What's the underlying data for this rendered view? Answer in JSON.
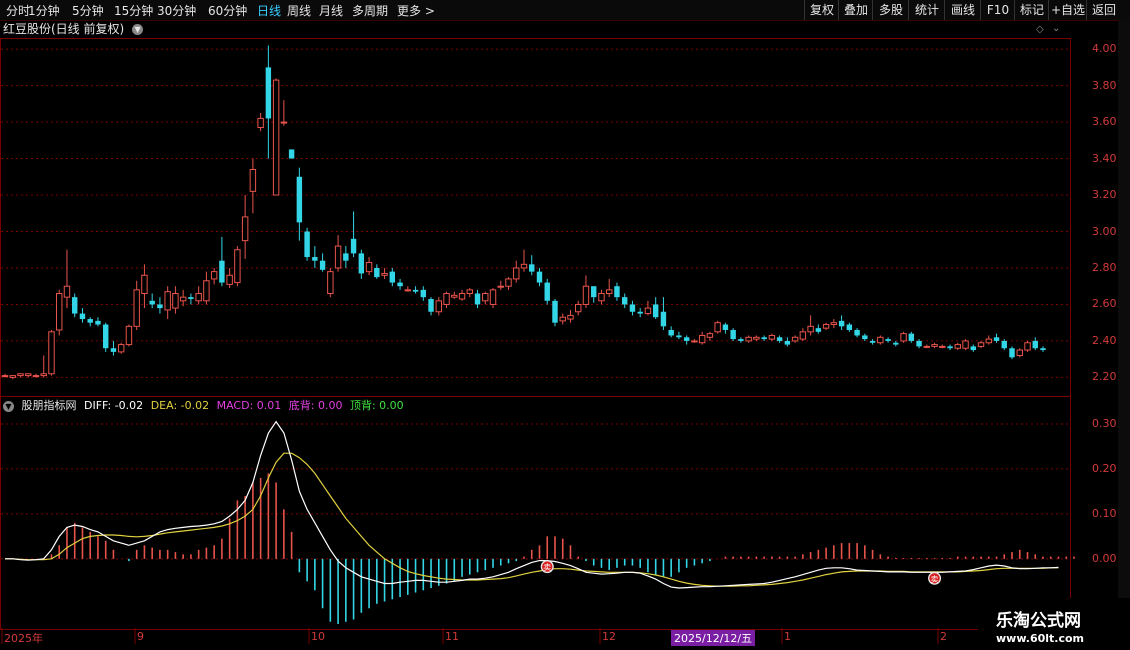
{
  "toolbar": {
    "periods": [
      "分时",
      "1分钟",
      "5分钟",
      "15分钟",
      "30分钟",
      "60分钟",
      "日线",
      "周线",
      "月线",
      "多周期",
      "更多 >"
    ],
    "active_period": "日线",
    "right_buttons": [
      "复权",
      "叠加",
      "多股",
      "统计",
      "画线",
      "F10",
      "标记",
      "+自选",
      "返回"
    ]
  },
  "stock": {
    "title": "红豆股份(日线 前复权)"
  },
  "indicator": {
    "name": "股朋指标网",
    "diff": "DIFF: -0.02",
    "dea": "DEA: -0.02",
    "macd": "MACD: 0.01",
    "dibei": "底背: 0.00",
    "dingbei": "顶背: 0.00"
  },
  "price_axis": [
    "4.00",
    "3.80",
    "3.60",
    "3.40",
    "3.20",
    "3.00",
    "2.80",
    "2.60",
    "2.40",
    "2.20"
  ],
  "macd_axis": [
    "0.30",
    "0.20",
    "0.10",
    "0.00"
  ],
  "x_axis": [
    "2025年",
    "9",
    "10",
    "11",
    "12",
    "1",
    "2"
  ],
  "selected_date": "2025/12/12/五",
  "markers": [
    "卖",
    "卖"
  ],
  "watermark": {
    "line1": "乐淘公式网",
    "line2": "www.60lt.com"
  },
  "colors": {
    "up": "#e8544b",
    "down": "#33d6e6",
    "diff": "#ffffff",
    "dea": "#e0d040",
    "macd_label": "#e040e0",
    "dibei": "#e040e0",
    "dingbei": "#40e040",
    "grid": "#7a0000"
  },
  "chart_data": {
    "type": "candlestick",
    "ylim": [
      2.12,
      4.05
    ],
    "candles": [
      [
        2.21,
        2.21,
        2.2,
        2.22
      ],
      [
        2.2,
        2.21,
        2.19,
        2.21
      ],
      [
        2.21,
        2.22,
        2.2,
        2.22
      ],
      [
        2.21,
        2.22,
        2.2,
        2.22
      ],
      [
        2.21,
        2.21,
        2.2,
        2.22
      ],
      [
        2.21,
        2.22,
        2.2,
        2.32
      ],
      [
        2.22,
        2.45,
        2.21,
        2.46
      ],
      [
        2.46,
        2.66,
        2.43,
        2.68
      ],
      [
        2.64,
        2.7,
        2.58,
        2.9
      ],
      [
        2.64,
        2.55,
        2.53,
        2.66
      ],
      [
        2.55,
        2.52,
        2.5,
        2.58
      ],
      [
        2.52,
        2.5,
        2.48,
        2.53
      ],
      [
        2.51,
        2.49,
        2.48,
        2.53
      ],
      [
        2.49,
        2.36,
        2.34,
        2.5
      ],
      [
        2.36,
        2.34,
        2.32,
        2.4
      ],
      [
        2.34,
        2.38,
        2.33,
        2.39
      ],
      [
        2.38,
        2.48,
        2.37,
        2.49
      ],
      [
        2.48,
        2.68,
        2.46,
        2.73
      ],
      [
        2.66,
        2.76,
        2.58,
        2.82
      ],
      [
        2.62,
        2.6,
        2.58,
        2.66
      ],
      [
        2.6,
        2.58,
        2.55,
        2.64
      ],
      [
        2.57,
        2.67,
        2.52,
        2.7
      ],
      [
        2.58,
        2.66,
        2.55,
        2.7
      ],
      [
        2.62,
        2.64,
        2.59,
        2.68
      ],
      [
        2.64,
        2.63,
        2.6,
        2.66
      ],
      [
        2.62,
        2.66,
        2.6,
        2.7
      ],
      [
        2.62,
        2.73,
        2.6,
        2.78
      ],
      [
        2.74,
        2.78,
        2.71,
        2.8
      ],
      [
        2.84,
        2.72,
        2.7,
        2.97
      ],
      [
        2.71,
        2.76,
        2.69,
        2.8
      ],
      [
        2.72,
        2.9,
        2.7,
        2.92
      ],
      [
        2.95,
        3.08,
        2.85,
        3.2
      ],
      [
        3.22,
        3.34,
        3.1,
        3.4
      ],
      [
        3.57,
        3.62,
        3.55,
        3.65
      ],
      [
        3.9,
        3.62,
        3.4,
        4.02
      ],
      [
        3.2,
        3.83,
        3.2,
        3.84
      ],
      [
        3.6,
        3.6,
        3.58,
        3.72
      ],
      [
        3.45,
        3.4,
        3.4,
        3.45
      ],
      [
        3.3,
        3.05,
        2.95,
        3.35
      ],
      [
        3.0,
        2.86,
        2.84,
        3.02
      ],
      [
        2.86,
        2.84,
        2.8,
        2.92
      ],
      [
        2.84,
        2.79,
        2.78,
        2.88
      ],
      [
        2.66,
        2.78,
        2.64,
        2.8
      ],
      [
        2.8,
        2.92,
        2.78,
        2.98
      ],
      [
        2.88,
        2.84,
        2.8,
        2.92
      ],
      [
        2.96,
        2.88,
        2.86,
        3.11
      ],
      [
        2.88,
        2.77,
        2.74,
        2.9
      ],
      [
        2.78,
        2.83,
        2.76,
        2.86
      ],
      [
        2.8,
        2.75,
        2.74,
        2.82
      ],
      [
        2.76,
        2.77,
        2.74,
        2.8
      ],
      [
        2.78,
        2.72,
        2.7,
        2.8
      ],
      [
        2.72,
        2.7,
        2.68,
        2.74
      ],
      [
        2.68,
        2.68,
        2.67,
        2.7
      ],
      [
        2.68,
        2.67,
        2.66,
        2.7
      ],
      [
        2.68,
        2.64,
        2.62,
        2.7
      ],
      [
        2.63,
        2.56,
        2.54,
        2.64
      ],
      [
        2.56,
        2.62,
        2.54,
        2.64
      ],
      [
        2.6,
        2.66,
        2.58,
        2.67
      ],
      [
        2.64,
        2.65,
        2.63,
        2.67
      ],
      [
        2.63,
        2.66,
        2.62,
        2.68
      ],
      [
        2.66,
        2.68,
        2.64,
        2.69
      ],
      [
        2.66,
        2.6,
        2.58,
        2.68
      ],
      [
        2.62,
        2.66,
        2.6,
        2.67
      ],
      [
        2.6,
        2.68,
        2.58,
        2.69
      ],
      [
        2.7,
        2.7,
        2.68,
        2.73
      ],
      [
        2.7,
        2.74,
        2.68,
        2.75
      ],
      [
        2.74,
        2.8,
        2.72,
        2.84
      ],
      [
        2.8,
        2.82,
        2.78,
        2.9
      ],
      [
        2.82,
        2.78,
        2.76,
        2.87
      ],
      [
        2.78,
        2.72,
        2.7,
        2.8
      ],
      [
        2.72,
        2.62,
        2.6,
        2.74
      ],
      [
        2.62,
        2.5,
        2.48,
        2.63
      ],
      [
        2.51,
        2.53,
        2.49,
        2.55
      ],
      [
        2.52,
        2.54,
        2.5,
        2.57
      ],
      [
        2.56,
        2.6,
        2.54,
        2.62
      ],
      [
        2.6,
        2.7,
        2.58,
        2.76
      ],
      [
        2.7,
        2.64,
        2.61,
        2.7
      ],
      [
        2.62,
        2.66,
        2.6,
        2.68
      ],
      [
        2.66,
        2.68,
        2.64,
        2.74
      ],
      [
        2.7,
        2.64,
        2.62,
        2.72
      ],
      [
        2.64,
        2.6,
        2.58,
        2.66
      ],
      [
        2.6,
        2.56,
        2.54,
        2.62
      ],
      [
        2.56,
        2.55,
        2.53,
        2.58
      ],
      [
        2.55,
        2.58,
        2.54,
        2.62
      ],
      [
        2.6,
        2.53,
        2.52,
        2.64
      ],
      [
        2.56,
        2.48,
        2.46,
        2.64
      ],
      [
        2.46,
        2.43,
        2.42,
        2.48
      ],
      [
        2.43,
        2.42,
        2.41,
        2.45
      ],
      [
        2.42,
        2.4,
        2.38,
        2.43
      ],
      [
        2.4,
        2.4,
        2.39,
        2.41
      ],
      [
        2.39,
        2.43,
        2.38,
        2.45
      ],
      [
        2.42,
        2.44,
        2.4,
        2.45
      ],
      [
        2.45,
        2.5,
        2.44,
        2.51
      ],
      [
        2.49,
        2.46,
        2.44,
        2.5
      ],
      [
        2.46,
        2.41,
        2.4,
        2.47
      ],
      [
        2.41,
        2.4,
        2.39,
        2.42
      ],
      [
        2.4,
        2.42,
        2.39,
        2.43
      ],
      [
        2.41,
        2.42,
        2.4,
        2.43
      ],
      [
        2.42,
        2.41,
        2.4,
        2.43
      ],
      [
        2.41,
        2.43,
        2.4,
        2.44
      ],
      [
        2.42,
        2.4,
        2.39,
        2.43
      ],
      [
        2.4,
        2.38,
        2.37,
        2.42
      ],
      [
        2.4,
        2.42,
        2.39,
        2.43
      ],
      [
        2.41,
        2.45,
        2.4,
        2.47
      ],
      [
        2.45,
        2.48,
        2.43,
        2.54
      ],
      [
        2.47,
        2.45,
        2.44,
        2.49
      ],
      [
        2.47,
        2.49,
        2.46,
        2.5
      ],
      [
        2.49,
        2.5,
        2.47,
        2.52
      ],
      [
        2.51,
        2.48,
        2.46,
        2.54
      ],
      [
        2.49,
        2.46,
        2.45,
        2.5
      ],
      [
        2.46,
        2.43,
        2.42,
        2.47
      ],
      [
        2.43,
        2.41,
        2.4,
        2.44
      ],
      [
        2.4,
        2.39,
        2.38,
        2.41
      ],
      [
        2.39,
        2.42,
        2.38,
        2.43
      ],
      [
        2.41,
        2.4,
        2.39,
        2.42
      ],
      [
        2.39,
        2.38,
        2.37,
        2.4
      ],
      [
        2.4,
        2.44,
        2.39,
        2.45
      ],
      [
        2.44,
        2.4,
        2.39,
        2.45
      ],
      [
        2.4,
        2.37,
        2.36,
        2.41
      ],
      [
        2.37,
        2.37,
        2.36,
        2.38
      ],
      [
        2.37,
        2.38,
        2.36,
        2.39
      ],
      [
        2.37,
        2.37,
        2.36,
        2.38
      ],
      [
        2.37,
        2.36,
        2.35,
        2.38
      ],
      [
        2.36,
        2.38,
        2.35,
        2.39
      ],
      [
        2.36,
        2.4,
        2.35,
        2.41
      ],
      [
        2.37,
        2.35,
        2.34,
        2.38
      ],
      [
        2.37,
        2.39,
        2.36,
        2.4
      ],
      [
        2.39,
        2.41,
        2.38,
        2.43
      ],
      [
        2.42,
        2.4,
        2.39,
        2.44
      ],
      [
        2.4,
        2.36,
        2.35,
        2.41
      ],
      [
        2.36,
        2.31,
        2.3,
        2.37
      ],
      [
        2.32,
        2.35,
        2.31,
        2.36
      ],
      [
        2.35,
        2.39,
        2.34,
        2.4
      ],
      [
        2.4,
        2.36,
        2.35,
        2.42
      ],
      [
        2.36,
        2.35,
        2.34,
        2.37
      ]
    ],
    "macd": {
      "ylim": [
        -0.145,
        0.32
      ],
      "hist": [
        0.0,
        0.0,
        0.0,
        0.0,
        0.0,
        0.0,
        0.01,
        0.03,
        0.07,
        0.08,
        0.07,
        0.06,
        0.05,
        0.04,
        0.02,
        0.0,
        -0.005,
        0.02,
        0.03,
        0.025,
        0.02,
        0.02,
        0.015,
        0.01,
        0.01,
        0.02,
        0.025,
        0.03,
        0.045,
        0.09,
        0.13,
        0.14,
        0.17,
        0.18,
        0.19,
        0.17,
        0.11,
        0.06,
        -0.03,
        -0.05,
        -0.07,
        -0.11,
        -0.14,
        -0.145,
        -0.14,
        -0.135,
        -0.12,
        -0.11,
        -0.1,
        -0.095,
        -0.09,
        -0.085,
        -0.08,
        -0.075,
        -0.07,
        -0.065,
        -0.06,
        -0.055,
        -0.05,
        -0.04,
        -0.035,
        -0.03,
        -0.025,
        -0.02,
        -0.015,
        -0.01,
        -0.005,
        0.005,
        0.02,
        0.03,
        0.05,
        0.05,
        0.045,
        0.03,
        0.005,
        -0.005,
        -0.015,
        -0.02,
        -0.025,
        -0.02,
        -0.015,
        -0.015,
        -0.02,
        -0.03,
        -0.035,
        -0.04,
        -0.04,
        -0.03,
        -0.02,
        -0.015,
        -0.01,
        -0.005,
        0.0,
        0.005,
        0.005,
        0.005,
        0.005,
        0.005,
        0.005,
        0.005,
        0.005,
        0.005,
        0.005,
        0.01,
        0.015,
        0.02,
        0.025,
        0.03,
        0.035,
        0.035,
        0.035,
        0.03,
        0.02,
        0.01,
        0.005,
        0.002,
        0.002,
        0.002,
        0.002,
        0.002,
        0.002,
        0.002,
        0.002,
        0.005,
        0.005,
        0.005,
        0.005,
        0.005,
        0.005,
        0.01,
        0.015,
        0.02,
        0.015,
        0.01,
        0.005,
        0.005,
        0.005,
        0.005,
        0.005
      ],
      "diff": [
        0.0,
        0.0,
        -0.002,
        -0.003,
        -0.002,
        0.0,
        0.02,
        0.05,
        0.07,
        0.075,
        0.072,
        0.065,
        0.06,
        0.05,
        0.04,
        0.035,
        0.03,
        0.035,
        0.04,
        0.05,
        0.06,
        0.065,
        0.068,
        0.07,
        0.072,
        0.073,
        0.075,
        0.078,
        0.083,
        0.095,
        0.11,
        0.13,
        0.17,
        0.23,
        0.28,
        0.305,
        0.28,
        0.22,
        0.15,
        0.11,
        0.08,
        0.05,
        0.02,
        -0.005,
        -0.02,
        -0.03,
        -0.04,
        -0.045,
        -0.05,
        -0.055,
        -0.055,
        -0.052,
        -0.05,
        -0.048,
        -0.048,
        -0.05,
        -0.052,
        -0.052,
        -0.05,
        -0.048,
        -0.045,
        -0.045,
        -0.043,
        -0.04,
        -0.035,
        -0.03,
        -0.022,
        -0.015,
        -0.008,
        -0.004,
        -0.004,
        -0.006,
        -0.01,
        -0.015,
        -0.022,
        -0.03,
        -0.032,
        -0.034,
        -0.033,
        -0.032,
        -0.03,
        -0.03,
        -0.032,
        -0.038,
        -0.045,
        -0.055,
        -0.063,
        -0.065,
        -0.064,
        -0.063,
        -0.062,
        -0.062,
        -0.061,
        -0.06,
        -0.059,
        -0.058,
        -0.057,
        -0.056,
        -0.055,
        -0.052,
        -0.048,
        -0.044,
        -0.04,
        -0.035,
        -0.03,
        -0.025,
        -0.021,
        -0.02,
        -0.02,
        -0.022,
        -0.025,
        -0.026,
        -0.027,
        -0.028,
        -0.029,
        -0.029,
        -0.029,
        -0.03,
        -0.03,
        -0.03,
        -0.03,
        -0.03,
        -0.029,
        -0.028,
        -0.027,
        -0.024,
        -0.02,
        -0.016,
        -0.014,
        -0.016,
        -0.02,
        -0.022,
        -0.022,
        -0.021,
        -0.02,
        -0.02,
        -0.019
      ],
      "dea": [
        0.0,
        0.0,
        -0.001,
        -0.002,
        -0.002,
        -0.002,
        0.0,
        0.01,
        0.025,
        0.035,
        0.045,
        0.05,
        0.052,
        0.053,
        0.053,
        0.052,
        0.05,
        0.049,
        0.05,
        0.052,
        0.055,
        0.058,
        0.06,
        0.062,
        0.064,
        0.066,
        0.068,
        0.07,
        0.073,
        0.078,
        0.085,
        0.095,
        0.11,
        0.14,
        0.18,
        0.215,
        0.235,
        0.235,
        0.225,
        0.21,
        0.19,
        0.165,
        0.14,
        0.115,
        0.09,
        0.07,
        0.05,
        0.03,
        0.015,
        0.0,
        -0.01,
        -0.02,
        -0.028,
        -0.033,
        -0.037,
        -0.04,
        -0.043,
        -0.045,
        -0.046,
        -0.047,
        -0.047,
        -0.047,
        -0.046,
        -0.045,
        -0.044,
        -0.042,
        -0.038,
        -0.034,
        -0.03,
        -0.027,
        -0.024,
        -0.022,
        -0.022,
        -0.023,
        -0.025,
        -0.027,
        -0.028,
        -0.029,
        -0.03,
        -0.03,
        -0.03,
        -0.03,
        -0.031,
        -0.033,
        -0.036,
        -0.04,
        -0.045,
        -0.05,
        -0.054,
        -0.057,
        -0.059,
        -0.06,
        -0.061,
        -0.061,
        -0.061,
        -0.06,
        -0.06,
        -0.059,
        -0.058,
        -0.057,
        -0.055,
        -0.053,
        -0.05,
        -0.047,
        -0.043,
        -0.039,
        -0.035,
        -0.032,
        -0.029,
        -0.028,
        -0.027,
        -0.027,
        -0.027,
        -0.027,
        -0.028,
        -0.028,
        -0.028,
        -0.029,
        -0.029,
        -0.029,
        -0.029,
        -0.029,
        -0.029,
        -0.029,
        -0.028,
        -0.027,
        -0.026,
        -0.024,
        -0.022,
        -0.021,
        -0.021,
        -0.021,
        -0.021,
        -0.021,
        -0.021,
        -0.02,
        -0.02
      ],
      "sell_signal_bars": [
        70,
        120
      ]
    }
  }
}
